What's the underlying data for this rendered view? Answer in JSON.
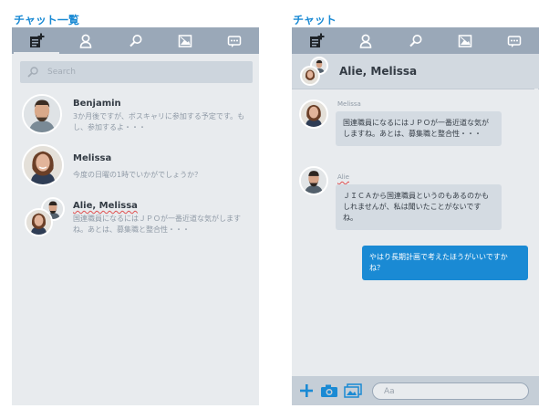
{
  "left_panel": {
    "title": "チャット一覧",
    "toolbar": [
      "new-chat-icon",
      "contacts-icon",
      "search-icon",
      "photo-icon",
      "messages-icon"
    ],
    "search": {
      "placeholder": "Search"
    },
    "chats": [
      {
        "name": "Benjamin",
        "message": "3か月後ですが、ボスキャリに参加する予定です。もし、参加するよ・・・"
      },
      {
        "name": "Melissa",
        "message": "今度の日曜の1時でいかがでしょうか？"
      },
      {
        "name": "Alie, Melissa",
        "message": "国連職員になるにはＪＰＯが一番近道な気がしますね。あとは、募集職と整合性・・・"
      }
    ]
  },
  "right_panel": {
    "title": "チャット",
    "header": {
      "name": "Alie, Melissa"
    },
    "messages": [
      {
        "sender": "Melissa",
        "text": "国連職員になるにはＪＰＯが一番近道な気がしますね。あとは、募集職と整合性・・・"
      },
      {
        "sender": "Alie",
        "text": "ＪＩＣＡから国連職員というのもあるのかもしれませんが、私は聞いたことがないですね。"
      },
      {
        "sender": "",
        "text": "やはり長期計画で考えたほうがいいですかね？"
      }
    ],
    "composer": {
      "placeholder": "Aa"
    }
  },
  "colors": {
    "accent": "#1a8ad4",
    "toolbar": "#9aa8b8",
    "panel": "#e8ebee",
    "bubble_in": "#d4dbe2"
  }
}
